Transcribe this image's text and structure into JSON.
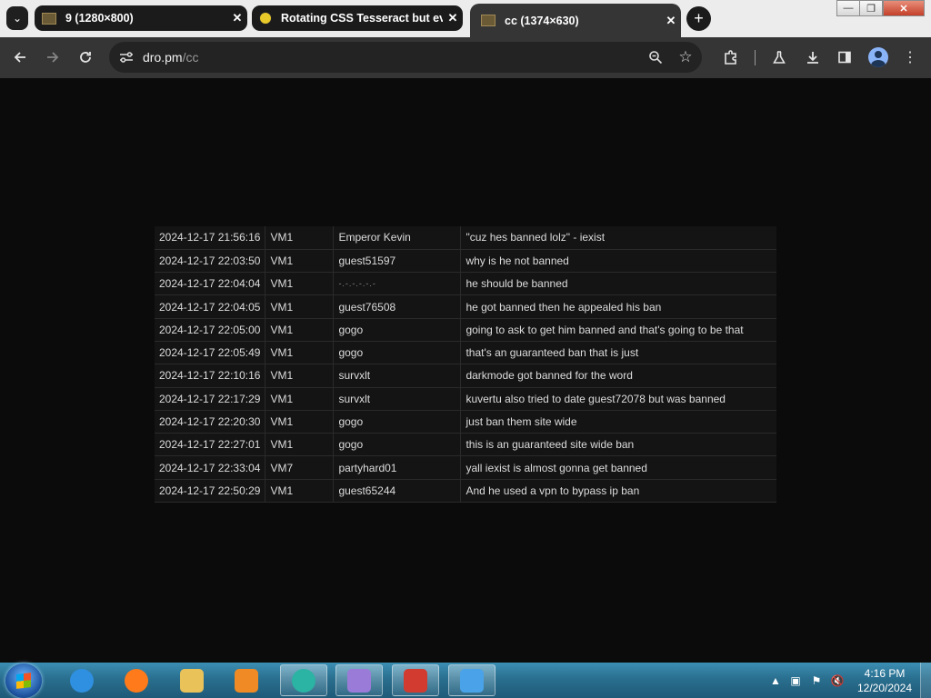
{
  "browser": {
    "tabs": [
      {
        "title": "9 (1280×800)",
        "active": false
      },
      {
        "title": "Rotating CSS Tesseract but eve",
        "active": false
      },
      {
        "title": "cc (1374×630)",
        "active": true
      }
    ],
    "address": {
      "host": "dro.pm",
      "path": "/cc"
    },
    "window_buttons": {
      "minimize": "—",
      "restore": "❐",
      "close": "✕"
    }
  },
  "log_table": {
    "rows": [
      {
        "time": "2024-12-17 21:56:16",
        "vm": "VM1",
        "user": "Emperor Kevin",
        "message": "\"cuz hes banned lolz\" - iexist"
      },
      {
        "time": "2024-12-17 22:03:50",
        "vm": "VM1",
        "user": "guest51597",
        "message": "why is he not banned"
      },
      {
        "time": "2024-12-17 22:04:04",
        "vm": "VM1",
        "user": "-.-.-.-.-.-",
        "message": "he should be banned"
      },
      {
        "time": "2024-12-17 22:04:05",
        "vm": "VM1",
        "user": "guest76508",
        "message": "he got banned then he appealed his ban"
      },
      {
        "time": "2024-12-17 22:05:00",
        "vm": "VM1",
        "user": "gogo",
        "message": "going to ask to get him banned and that's going to be that"
      },
      {
        "time": "2024-12-17 22:05:49",
        "vm": "VM1",
        "user": "gogo",
        "message": "that's an guaranteed ban that is just"
      },
      {
        "time": "2024-12-17 22:10:16",
        "vm": "VM1",
        "user": "survxlt",
        "message": "darkmode got banned for the word"
      },
      {
        "time": "2024-12-17 22:17:29",
        "vm": "VM1",
        "user": "survxlt",
        "message": "kuvertu also tried to date guest72078 but was banned"
      },
      {
        "time": "2024-12-17 22:20:30",
        "vm": "VM1",
        "user": "gogo",
        "message": "just ban them site wide"
      },
      {
        "time": "2024-12-17 22:27:01",
        "vm": "VM1",
        "user": "gogo",
        "message": "this is an guaranteed site wide ban"
      },
      {
        "time": "2024-12-17 22:33:04",
        "vm": "VM7",
        "user": "partyhard01",
        "message": "yall iexist is almost gonna get banned"
      },
      {
        "time": "2024-12-17 22:50:29",
        "vm": "VM1",
        "user": "guest65244",
        "message": "And he used a vpn to bypass ip ban"
      }
    ]
  },
  "taskbar": {
    "apps": [
      {
        "name": "internet-explorer",
        "color": "#2f8fe0"
      },
      {
        "name": "firefox",
        "color": "#ff7a1a"
      },
      {
        "name": "file-explorer",
        "color": "#e9c25a"
      },
      {
        "name": "media-player",
        "color": "#f08a24"
      },
      {
        "name": "active-app",
        "color": "#2bb3a3"
      },
      {
        "name": "paint",
        "color": "#9b7bd8"
      },
      {
        "name": "toolbox",
        "color": "#d23b2f"
      },
      {
        "name": "windows-app",
        "color": "#4aa3e8"
      }
    ],
    "clock": {
      "time": "4:16 PM",
      "date": "12/20/2024"
    }
  }
}
